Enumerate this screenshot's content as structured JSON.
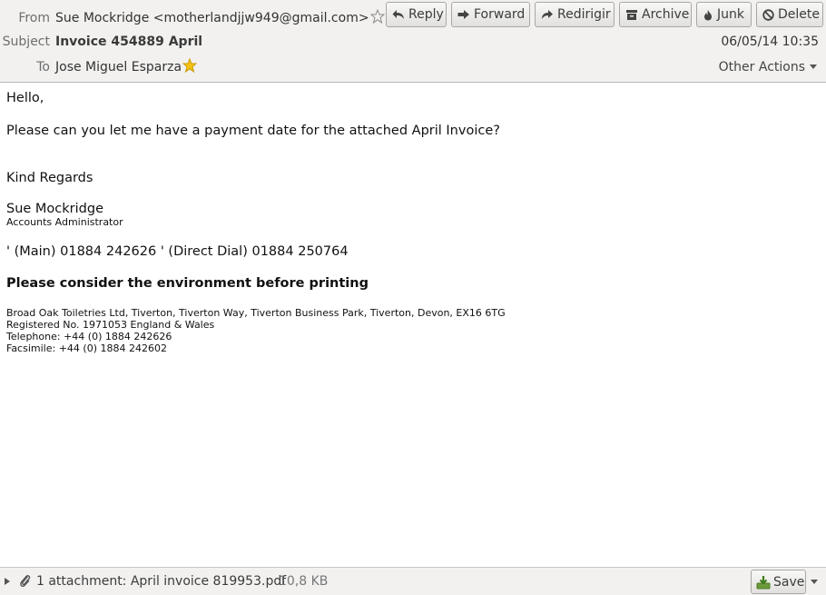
{
  "header": {
    "from_label": "From",
    "from_value": "Sue Mockridge <motherlandjjw949@gmail.com>",
    "subject_label": "Subject",
    "subject_value": "Invoice 454889 April",
    "to_label": "To",
    "to_value": "Jose Miguel Esparza",
    "date": "06/05/14 10:35",
    "other_actions": "Other Actions"
  },
  "toolbar": {
    "reply": "Reply",
    "forward": "Forward",
    "redirect": "Redirigir",
    "archive": "Archive",
    "junk": "Junk",
    "delete": "Delete"
  },
  "message": {
    "greeting": "Hello,",
    "line1": "Please can you let me have a payment date for the attached April Invoice?",
    "regards": "Kind Regards",
    "sig_name": "Sue Mockridge",
    "sig_title": "Accounts Administrator",
    "phones": "' (Main) 01884 242626  ' (Direct Dial) 01884 250764",
    "env_note": "Please consider the environment before printing",
    "company_address": "Broad Oak Toiletries Ltd, Tiverton, Tiverton Way, Tiverton Business Park, Tiverton, Devon, EX16 6TG",
    "reg_no": "Registered No. 1971053 England & Wales",
    "telephone": "Telephone: +44 (0) 1884 242626",
    "facsimile": "Facsimile: +44 (0) 1884 242602"
  },
  "attachments": {
    "summary": "1 attachment: April invoice 819953.pdf",
    "size": "10,8 KB",
    "save_label": "Save"
  },
  "colors": {
    "header_bg": "#f2f1f0",
    "star_filled": "#f5c211",
    "border": "#b9b7b3"
  }
}
